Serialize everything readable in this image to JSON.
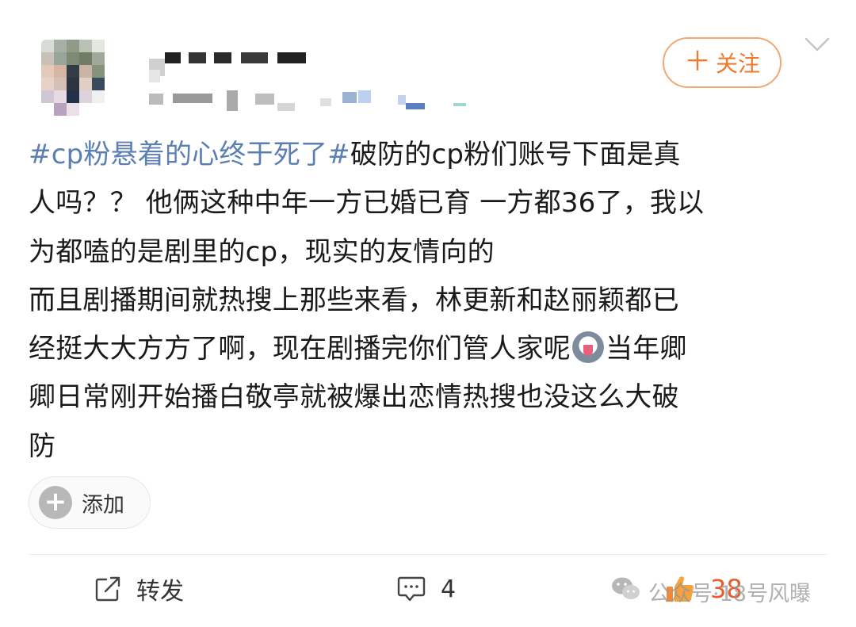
{
  "header": {
    "follow_label": "关注",
    "follow_plus": "＋"
  },
  "post": {
    "topic": "#cp粉悬着的心终于死了#",
    "lines": [
      "破防的cp粉们账号下面是真",
      "人吗？？ 他俩这种中年一方已婚已育 一方都36了，我以",
      "为都嗑的是剧里的cp，现实的友情向的",
      "而且剧播期间就热搜上那些来看，林更新和赵丽颖都已",
      "经挺大大方方了啊，现在剧播完你们管人家呢",
      "当年卿",
      "卿日常刚开始播白敬亭就被爆出恋情热搜也没这么大破",
      "防"
    ]
  },
  "add_chip": {
    "label": "添加",
    "plus": "+"
  },
  "actions": {
    "repost_label": "转发",
    "comment_count": "4",
    "like_count": "38"
  },
  "watermark": {
    "text": "公众号·18号风曝"
  },
  "icons": {
    "more": "chevron-down-icon",
    "repost": "share-square-icon",
    "comment": "comment-bubble-icon",
    "like": "thumbs-up-icon",
    "emoji": "dog-face-emoji-icon",
    "watermark": "wechat-icon"
  },
  "colors": {
    "topic": "#5b7fb3",
    "follow": "#f07a2b",
    "like": "#ea5b30"
  }
}
